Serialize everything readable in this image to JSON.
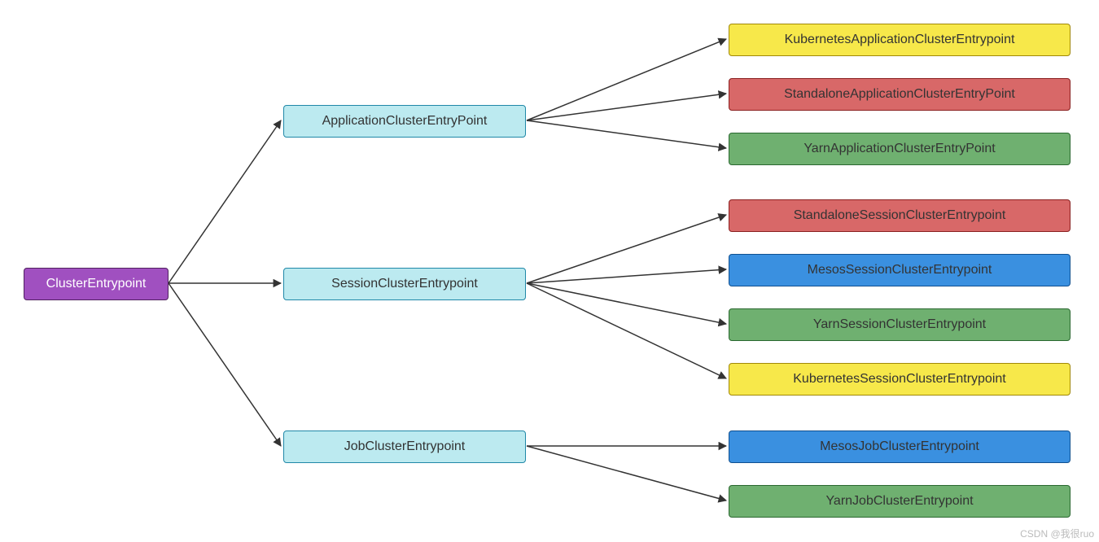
{
  "root": {
    "label": "ClusterEntrypoint"
  },
  "mid": {
    "app": {
      "label": "ApplicationClusterEntryPoint"
    },
    "session": {
      "label": "SessionClusterEntrypoint"
    },
    "job": {
      "label": "JobClusterEntrypoint"
    }
  },
  "leaves": {
    "app_k8s": {
      "label": "KubernetesApplicationClusterEntrypoint"
    },
    "app_standalone": {
      "label": "StandaloneApplicationClusterEntryPoint"
    },
    "app_yarn": {
      "label": "YarnApplicationClusterEntryPoint"
    },
    "sess_standalone": {
      "label": "StandaloneSessionClusterEntrypoint"
    },
    "sess_mesos": {
      "label": "MesosSessionClusterEntrypoint"
    },
    "sess_yarn": {
      "label": "YarnSessionClusterEntrypoint"
    },
    "sess_k8s": {
      "label": "KubernetesSessionClusterEntrypoint"
    },
    "job_mesos": {
      "label": "MesosJobClusterEntrypoint"
    },
    "job_yarn": {
      "label": "YarnJobClusterEntrypoint"
    }
  },
  "watermark": "CSDN @我很ruo",
  "colors": {
    "purple": "#a050c0",
    "cyan": "#bceaf0",
    "yellow": "#f7e84a",
    "red": "#d86868",
    "green": "#6fb070",
    "blue": "#3a90e0"
  }
}
